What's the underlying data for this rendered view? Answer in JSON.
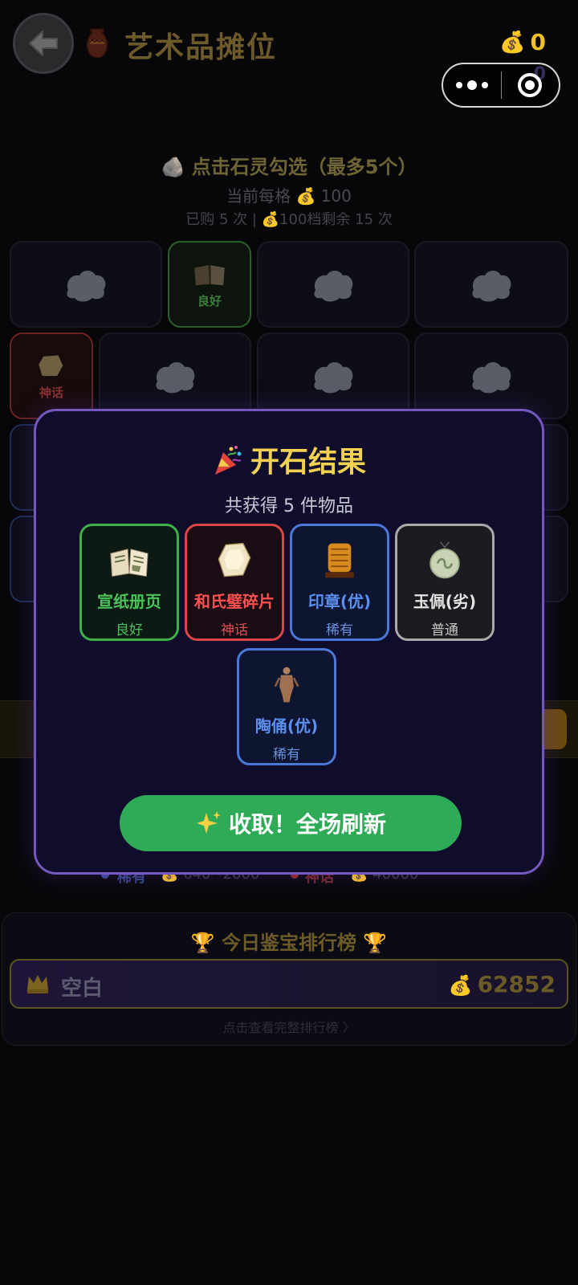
{
  "header": {
    "title": "艺术品摊位",
    "coins": "0",
    "coin_icon": "money-bag-icon",
    "gems": "0"
  },
  "selection": {
    "title": "点击石灵勾选（最多5个）",
    "price_line": "当前每格 💰 100",
    "buy_line": "已购 5 次 | 💰100档剩余 15 次"
  },
  "grid": {
    "cell_tags": {
      "good": "良好",
      "myth": "神话"
    }
  },
  "legend": {
    "rare_label": "稀有",
    "rare_range": "💰 640~2000",
    "myth_label": "神话",
    "myth_range": "💰 40000",
    "rare_color": "#3a4fa0",
    "myth_color": "#9a2a2a"
  },
  "ranking": {
    "title": "今日鉴宝排行榜",
    "top_name": "空白",
    "top_score": "62852",
    "hint": "点击查看完整排行榜 〉"
  },
  "modal": {
    "title": "开石结果",
    "subtitle": "共获得 5 件物品",
    "items": [
      {
        "name": "宣纸册页",
        "rarity": "良好",
        "icon": "book-icon",
        "color": "#4cc35a"
      },
      {
        "name": "和氏璧碎片",
        "rarity": "神话",
        "icon": "jade-fragment-icon",
        "color": "#ff5050"
      },
      {
        "name": "印章(优)",
        "rarity": "稀有",
        "icon": "seal-icon",
        "color": "#5b8ff0"
      },
      {
        "name": "玉佩(劣)",
        "rarity": "普通",
        "icon": "jade-pendant-icon",
        "color": "#e4e4e4"
      },
      {
        "name": "陶俑(优)",
        "rarity": "稀有",
        "icon": "terracotta-figure-icon",
        "color": "#5b8ff0"
      }
    ],
    "collect_label": "收取！全场刷新"
  },
  "colors": {
    "accent_gold": "#f2d050",
    "modal_border": "#7458bf",
    "collect_green": "#2fab58"
  }
}
